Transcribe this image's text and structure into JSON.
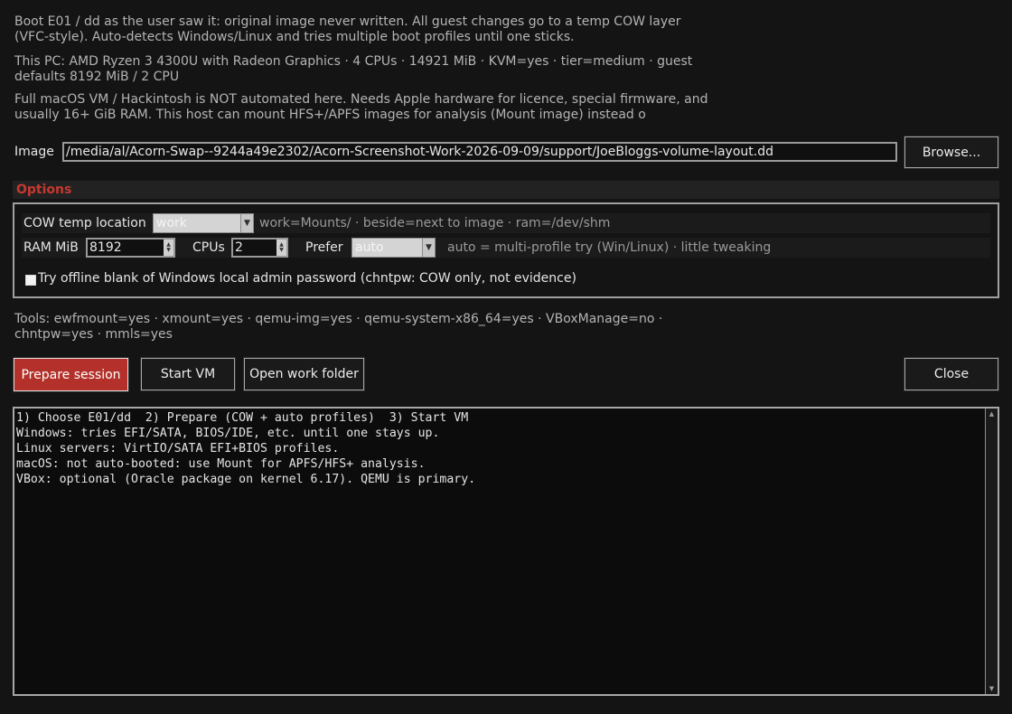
{
  "intro": {
    "line1": "Boot E01 / dd as the user saw it: original image never written. All guest changes go to a temp COW layer",
    "line2": "(VFC-style). Auto-detects Windows/Linux and tries multiple boot profiles until one sticks.",
    "line3": "This PC: AMD Ryzen 3 4300U with Radeon Graphics · 4 CPUs · 14921 MiB · KVM=yes · tier=medium · guest",
    "line4": "defaults 8192 MiB / 2 CPU",
    "line5": "Full macOS VM / Hackintosh is NOT automated here. Needs Apple hardware for licence, special firmware, and",
    "line6": "usually 16+ GiB RAM. This host can mount HFS+/APFS images for analysis (Mount image) instead o"
  },
  "image": {
    "label": "Image",
    "path": "/media/al/Acorn-Swap--9244a49e2302/Acorn-Screenshot-Work-2026-09-09/support/JoeBloggs-volume-layout.dd",
    "browse_label": "Browse..."
  },
  "options": {
    "header": "Options",
    "cow_label": "COW temp location",
    "cow_value": "work",
    "cow_hint": "work=Mounts/ · beside=next to image · ram=/dev/shm",
    "ram_label": "RAM MiB",
    "ram_value": "8192",
    "cpus_label": "CPUs",
    "cpus_value": "2",
    "prefer_label": "Prefer",
    "prefer_value": "auto",
    "prefer_hint": "auto = multi-profile try (Win/Linux) · little tweaking",
    "chntpw_label": "Try offline blank of Windows local admin password (chntpw: COW only, not evidence)",
    "chntpw_checked": false
  },
  "tools": {
    "line1": "Tools: ewfmount=yes · xmount=yes · qemu-img=yes · qemu-system-x86_64=yes · VBoxManage=no ·",
    "line2": "chntpw=yes · mmls=yes"
  },
  "buttons": {
    "prepare": "Prepare session",
    "start_vm": "Start VM",
    "open_folder": "Open work folder",
    "close": "Close"
  },
  "console": {
    "text": "1) Choose E01/dd  2) Prepare (COW + auto profiles)  3) Start VM\nWindows: tries EFI/SATA, BIOS/IDE, etc. until one stays up.\nLinux servers: VirtIO/SATA EFI+BIOS profiles.\nmacOS: not auto-booted: use Mount for APFS/HFS+ analysis.\nVBox: optional (Oracle package on kernel 6.17). QEMU is primary."
  },
  "colors": {
    "background": "#141414",
    "primary_button": "#b3312a",
    "options_header": "#c8382f"
  }
}
